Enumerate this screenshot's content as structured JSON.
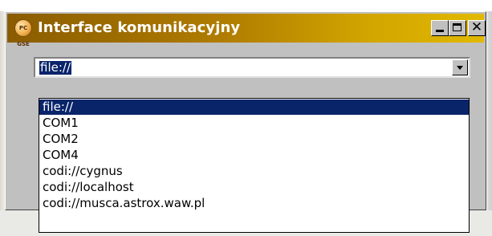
{
  "window": {
    "title": "Interface komunikacyjny",
    "icon": "app-logo-icon",
    "icon_label": "PC GSE",
    "controls": {
      "minimize": "minimize-icon",
      "maximize": "maximize-icon",
      "close": "close-icon",
      "close_glyph": "✕"
    }
  },
  "combo": {
    "selected": "file://",
    "arrow_icon": "chevron-down-icon"
  },
  "dropdown": {
    "items": [
      {
        "label": "file://",
        "selected": true
      },
      {
        "label": "COM1"
      },
      {
        "label": "COM2"
      },
      {
        "label": "COM4"
      },
      {
        "label": "codi://cygnus"
      },
      {
        "label": "codi://localhost"
      },
      {
        "label": "codi://musca.astrox.waw.pl"
      }
    ]
  },
  "colors": {
    "selection": "#0a246a",
    "titlebar_start": "#8a5c00",
    "titlebar_end": "#e1b900",
    "face": "#c0c0c0"
  }
}
